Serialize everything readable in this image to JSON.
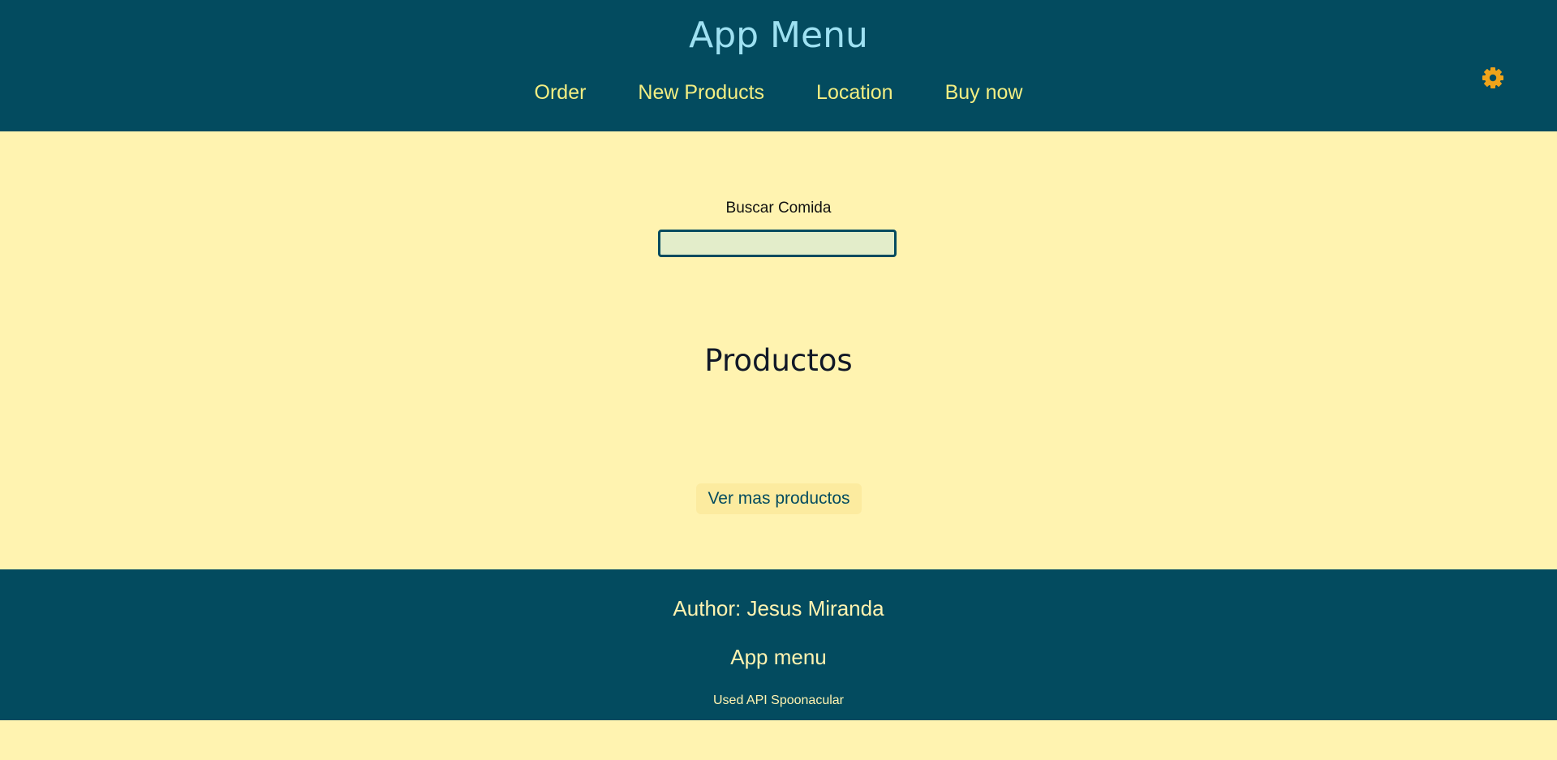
{
  "header": {
    "title": "App Menu",
    "nav": [
      "Order",
      "New Products",
      "Location",
      "Buy now"
    ],
    "settings_icon": "gear-icon"
  },
  "search": {
    "label": "Buscar Comida",
    "value": "",
    "placeholder": ""
  },
  "main": {
    "section_title": "Productos",
    "more_button": "Ver mas productos"
  },
  "footer": {
    "author": "Author: Jesus Miranda",
    "app_name": "App menu",
    "api_credit": "Used API Spoonacular"
  },
  "colors": {
    "header_bg": "#034b5f",
    "page_bg": "#fff3b0",
    "title": "#9ee1f2",
    "nav_link": "#f3ee82",
    "settings_icon": "#f0a31a"
  }
}
